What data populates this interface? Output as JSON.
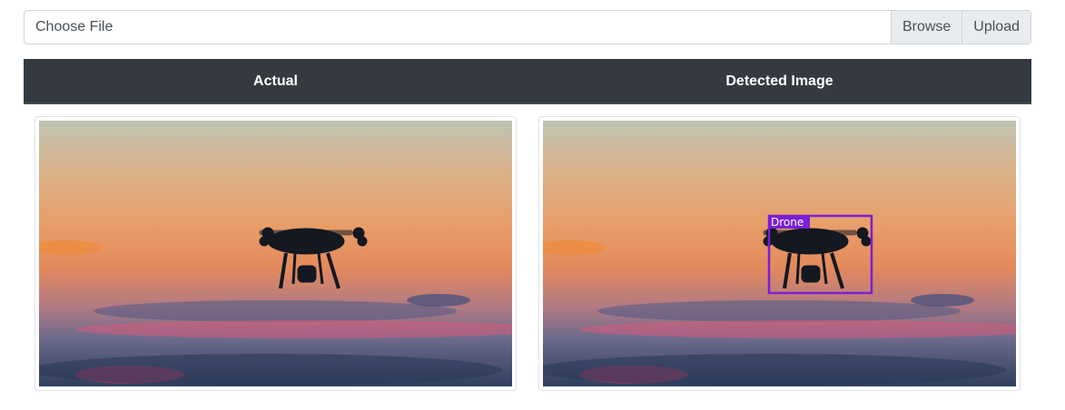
{
  "upload": {
    "choose_file_label": "Choose File",
    "browse_label": "Browse",
    "upload_label": "Upload"
  },
  "table": {
    "headers": [
      "Actual",
      "Detected Image"
    ]
  },
  "detection": {
    "label": "Drone",
    "box_color": "#7a1fd6"
  },
  "colors": {
    "header_bg": "#343a40",
    "input_addon_bg": "#e9ecef"
  }
}
